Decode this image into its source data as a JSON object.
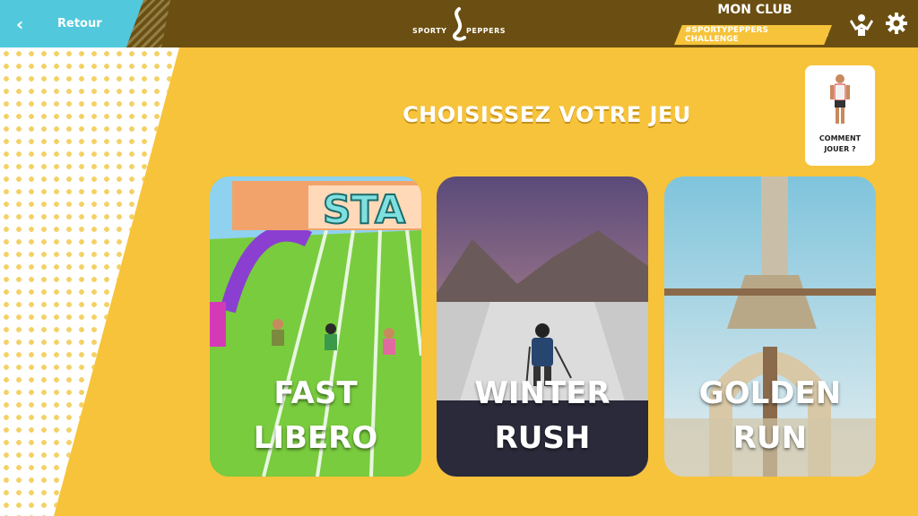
{
  "header": {
    "back_label": "Retour",
    "logo_left": "SPORTY",
    "logo_right": "PEPPERS",
    "club_title": "MON CLUB",
    "challenge_label": "#SPORTYPEPPERS CHALLENGE"
  },
  "main": {
    "heading": "CHOISISSEZ VOTRE JEU",
    "howto_line1": "COMMENT",
    "howto_line2": "JOUER ?",
    "games": [
      {
        "line1": "FAST",
        "line2": "LIBERO",
        "sign": "STA"
      },
      {
        "line1": "WINTER",
        "line2": "RUSH"
      },
      {
        "line1": "GOLDEN",
        "line2": "RUN"
      }
    ]
  },
  "colors": {
    "background": "#f6c33a",
    "topbar": "#6b4f12",
    "back": "#52c8dc"
  },
  "icons": [
    "chevron-left-icon",
    "muscle-icon",
    "gear-icon",
    "chevron-down-icon"
  ]
}
